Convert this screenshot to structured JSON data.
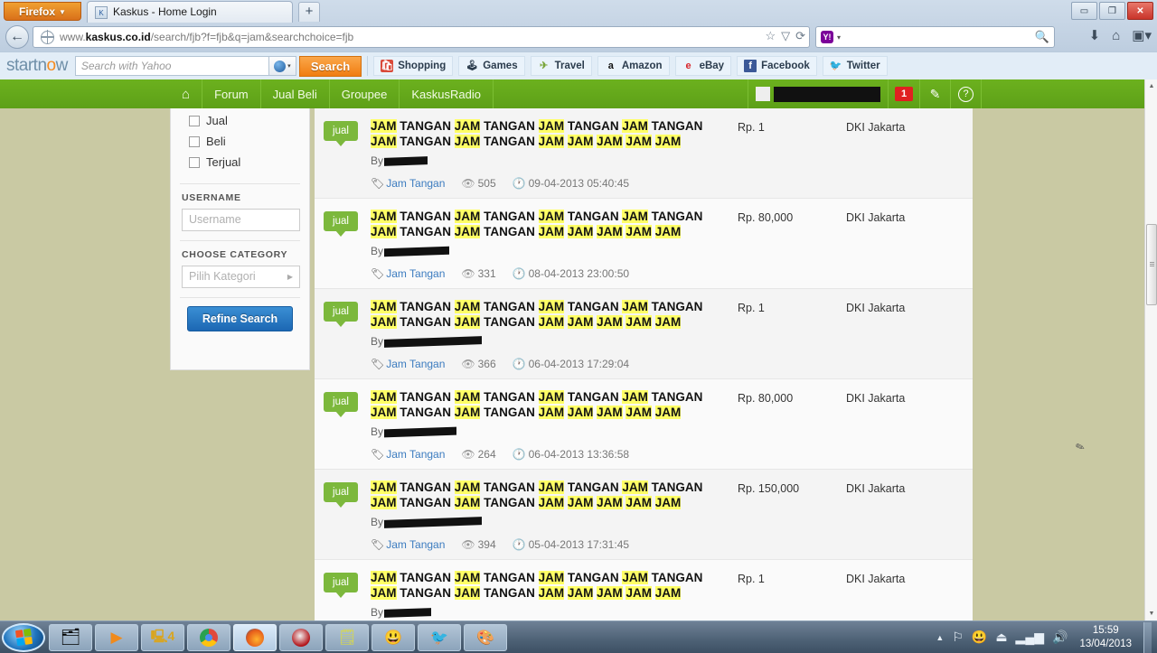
{
  "browser": {
    "app_button": "Firefox",
    "tab_title": "Kaskus - Home Login",
    "newtab_label": "+",
    "url_prefix": "www.",
    "url_domain": "kaskus.co.id",
    "url_path": "/search/fjb?f=fjb&q=jam&searchchoice=fjb",
    "search_placeholder": "",
    "window_minimize": "–",
    "window_restore": "❐",
    "window_close": "✕"
  },
  "startnow": {
    "logo_start": "start",
    "logo_o": "o",
    "logo_end": "w",
    "logo_n": "n",
    "search_placeholder": "Search with Yahoo",
    "search_button": "Search",
    "bookmarks": [
      {
        "label": "Shopping",
        "icon": "shopping-bag-icon"
      },
      {
        "label": "Games",
        "icon": "joystick-icon"
      },
      {
        "label": "Travel",
        "icon": "travel-icon"
      },
      {
        "label": "Amazon",
        "icon": "amazon-icon"
      },
      {
        "label": "eBay",
        "icon": "ebay-icon"
      },
      {
        "label": "Facebook",
        "icon": "facebook-icon"
      },
      {
        "label": "Twitter",
        "icon": "twitter-icon"
      }
    ]
  },
  "site_nav": {
    "home_icon": "home-icon",
    "items": [
      "Forum",
      "Jual Beli",
      "Groupee",
      "KaskusRadio"
    ],
    "username_redacted": "",
    "notification_count": "1",
    "compose_icon": "pencil-icon",
    "help_icon": "question-mark-icon"
  },
  "sidebar": {
    "checkboxes": [
      {
        "label": "Jual",
        "checked": false
      },
      {
        "label": "Beli",
        "checked": false
      },
      {
        "label": "Terjual",
        "checked": false
      }
    ],
    "username_label": "USERNAME",
    "username_placeholder": "Username",
    "category_label": "CHOOSE CATEGORY",
    "category_placeholder": "Pilih Kategori",
    "refine_button": "Refine Search"
  },
  "results": {
    "badge_label": "jual",
    "by_label": "By",
    "tag_label": "Jam Tangan",
    "title_tokens": [
      "JAM",
      "TANGAN",
      "JAM",
      "TANGAN",
      "JAM",
      "TANGAN",
      "JAM",
      "TANGAN",
      "JAM",
      "TANGAN",
      "JAM",
      "TANGAN",
      "JAM",
      "JAM",
      "JAM",
      "JAM",
      "JAM"
    ],
    "rows": [
      {
        "price": "Rp. 1",
        "location": "DKI Jakarta",
        "views": "505",
        "date": "09-04-2013 05:40:45",
        "author_width": 48
      },
      {
        "price": "Rp. 80,000",
        "location": "DKI Jakarta",
        "views": "331",
        "date": "08-04-2013 23:00:50",
        "author_width": 72
      },
      {
        "price": "Rp. 1",
        "location": "DKI Jakarta",
        "views": "366",
        "date": "06-04-2013 17:29:04",
        "author_width": 108
      },
      {
        "price": "Rp. 80,000",
        "location": "DKI Jakarta",
        "views": "264",
        "date": "06-04-2013 13:36:58",
        "author_width": 80
      },
      {
        "price": "Rp. 150,000",
        "location": "DKI Jakarta",
        "views": "394",
        "date": "05-04-2013 17:31:45",
        "author_width": 108
      },
      {
        "price": "Rp. 1",
        "location": "DKI Jakarta",
        "views": "",
        "date": "",
        "author_width": 52
      }
    ]
  },
  "taskbar": {
    "start_label": "Start",
    "items": [
      {
        "name": "windows-explorer",
        "icon": "folder-icon"
      },
      {
        "name": "media-player",
        "icon": "play-icon"
      },
      {
        "name": "idm-4",
        "icon": "download-manager-icon"
      },
      {
        "name": "google-chrome",
        "icon": "chrome-icon"
      },
      {
        "name": "mozilla-firefox",
        "icon": "firefox-icon"
      },
      {
        "name": "opera",
        "icon": "opera-icon"
      },
      {
        "name": "sticky-notes",
        "icon": "notes-icon"
      },
      {
        "name": "yahoo-messenger",
        "icon": "messenger-icon"
      },
      {
        "name": "twitter-app",
        "icon": "twitter-bird-icon"
      },
      {
        "name": "ms-paint",
        "icon": "paint-palette-icon"
      }
    ],
    "tray": [
      {
        "name": "show-hidden-icons",
        "icon": "chevron-up-icon"
      },
      {
        "name": "action-center",
        "icon": "flag-error-icon"
      },
      {
        "name": "yahoo-messenger-tray",
        "icon": "smiley-icon"
      },
      {
        "name": "safely-remove",
        "icon": "eject-icon"
      },
      {
        "name": "network",
        "icon": "signal-bars-icon"
      },
      {
        "name": "volume",
        "icon": "speaker-icon"
      }
    ],
    "time": "15:59",
    "date": "13/04/2013"
  },
  "colors": {
    "kaskus_green": "#6cb11e",
    "badge_red": "#e02020",
    "highlight_yellow": "#ffff66",
    "link_blue": "#3b7bbf",
    "button_blue": "#1c67b3",
    "orange": "#f07d11"
  }
}
